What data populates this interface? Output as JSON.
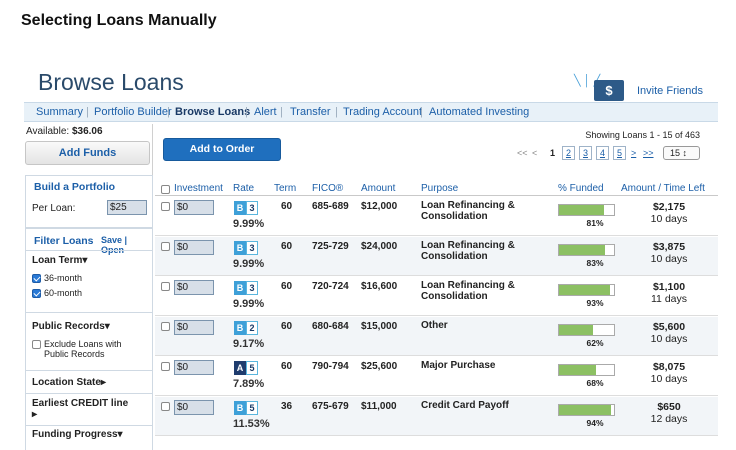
{
  "doc_heading": "Selecting Loans Manually",
  "page_title": "Browse Loans",
  "invite": {
    "label": "Invite Friends",
    "icon": "dollar-card-icon",
    "glyph": "$"
  },
  "nav": [
    "Summary",
    "Portfolio Builder",
    "Browse Loans",
    "Alert",
    "Transfer",
    "Trading Account",
    "Automated Investing"
  ],
  "nav_active": "Browse Loans",
  "sidebar": {
    "available_label": "Available:",
    "available_value": "$36.06",
    "add_funds": "Add Funds",
    "build_title": "Build a Portfolio",
    "per_loan_label": "Per Loan:",
    "per_loan_value": "$25",
    "filter_title": "Filter Loans",
    "filter_links": "Save | Open",
    "loan_term_title": "Loan Term▾",
    "term_36": "36-month",
    "term_60": "60-month",
    "public_records_title": "Public Records▾",
    "exclude_label": "Exclude Loans with Public Records",
    "location_title": "Location State▸",
    "credit_title": "Earliest CREDIT line",
    "credit_arrow": "▸",
    "funding_title": "Funding Progress▾"
  },
  "main": {
    "add_to_order": "Add to Order",
    "showing": "Showing Loans 1 - 15 of 463",
    "pager": {
      "first": "<<",
      "prev": "<",
      "current": "1",
      "pages": [
        "2",
        "3",
        "4",
        "5"
      ],
      "next": ">",
      "last": ">>"
    },
    "per_page": "15 ↕"
  },
  "columns": [
    "Investment",
    "Rate",
    "Term",
    "FICO®",
    "Amount",
    "Purpose",
    "% Funded",
    "Amount / Time Left"
  ],
  "loans": [
    {
      "investment": "$0",
      "grade": "B",
      "sub": "3",
      "grade_color": "#3ea0d8",
      "rate": "9.99%",
      "term": "60",
      "fico": "685-689",
      "amount": "$12,000",
      "purpose": "Loan Refinancing & Consolidation",
      "funded": 0.81,
      "funded_label": "81%",
      "remaining": "$2,175",
      "days": "10 days"
    },
    {
      "investment": "$0",
      "grade": "B",
      "sub": "3",
      "grade_color": "#3ea0d8",
      "rate": "9.99%",
      "term": "60",
      "fico": "725-729",
      "amount": "$24,000",
      "purpose": "Loan Refinancing & Consolidation",
      "funded": 0.83,
      "funded_label": "83%",
      "remaining": "$3,875",
      "days": "10 days"
    },
    {
      "investment": "$0",
      "grade": "B",
      "sub": "3",
      "grade_color": "#3ea0d8",
      "rate": "9.99%",
      "term": "60",
      "fico": "720-724",
      "amount": "$16,600",
      "purpose": "Loan Refinancing & Consolidation",
      "funded": 0.93,
      "funded_label": "93%",
      "remaining": "$1,100",
      "days": "11 days"
    },
    {
      "investment": "$0",
      "grade": "B",
      "sub": "2",
      "grade_color": "#3ea0d8",
      "rate": "9.17%",
      "term": "60",
      "fico": "680-684",
      "amount": "$15,000",
      "purpose": "Other",
      "funded": 0.62,
      "funded_label": "62%",
      "remaining": "$5,600",
      "days": "10 days"
    },
    {
      "investment": "$0",
      "grade": "A",
      "sub": "5",
      "grade_color": "#1f3c6e",
      "rate": "7.89%",
      "term": "60",
      "fico": "790-794",
      "amount": "$25,600",
      "purpose": "Major Purchase",
      "funded": 0.68,
      "funded_label": "68%",
      "remaining": "$8,075",
      "days": "10 days"
    },
    {
      "investment": "$0",
      "grade": "B",
      "sub": "5",
      "grade_color": "#3ea0d8",
      "rate": "11.53%",
      "term": "36",
      "fico": "675-679",
      "amount": "$11,000",
      "purpose": "Credit Card Payoff",
      "funded": 0.94,
      "funded_label": "94%",
      "remaining": "$650",
      "days": "12 days"
    }
  ],
  "colors": {
    "nav_bg": "#e8f1f8",
    "link": "#1c5fa8",
    "button": "#1f6fbe",
    "funded_fill": "#8cc063"
  }
}
